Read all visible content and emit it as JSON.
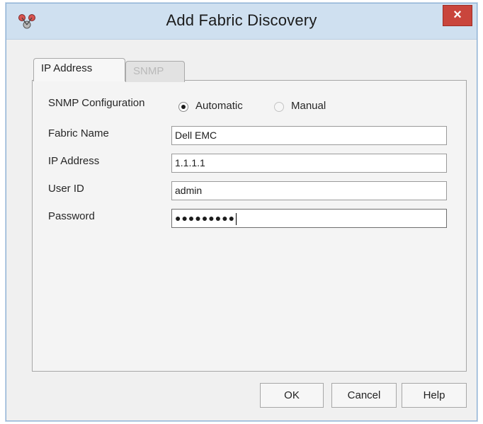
{
  "window": {
    "title": "Add Fabric Discovery",
    "close_label": "×",
    "app_icon": "fabric-app-icon"
  },
  "tabs": [
    {
      "label": "IP Address",
      "selected": true,
      "enabled": true
    },
    {
      "label": "SNMP",
      "selected": false,
      "enabled": false
    }
  ],
  "snmp": {
    "label": "SNMP Configuration",
    "options": [
      {
        "label": "Automatic",
        "selected": true,
        "enabled": true
      },
      {
        "label": "Manual",
        "selected": false,
        "enabled": false
      }
    ]
  },
  "form": {
    "fabric_name": {
      "label": "Fabric Name",
      "value": "Dell EMC"
    },
    "ip_address": {
      "label": "IP Address",
      "value": "1.1.1.1"
    },
    "user_id": {
      "label": "User ID",
      "value": "admin"
    },
    "password": {
      "label": "Password",
      "value": "●●●●●●●●●"
    }
  },
  "buttons": {
    "ok": "OK",
    "cancel": "Cancel",
    "help": "Help"
  },
  "colors": {
    "titlebar": "#cfe0f0",
    "close_button": "#c9453c",
    "window_bg": "#f0f0f0"
  }
}
